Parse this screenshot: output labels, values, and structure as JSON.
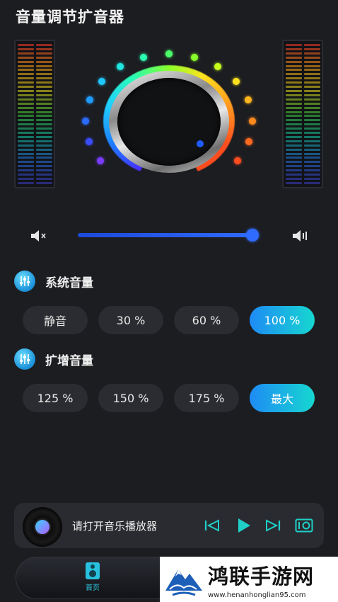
{
  "header": {
    "title": "音量调节扩音器"
  },
  "colors": {
    "background": "#1c1d21",
    "accent_blue": "#2f6bff",
    "active_gradient_start": "#1e8bf5",
    "active_gradient_end": "#16d7d0",
    "pill_bg": "#2b2c31"
  },
  "equalizer": {
    "left_icon": "equalizer-meter",
    "right_icon": "equalizer-meter"
  },
  "volume": {
    "level": 1.0,
    "mute_icon": "speaker-mute-icon",
    "volume_icon": "speaker-volume-icon"
  },
  "system_volume": {
    "label": "系统音量",
    "icon": "equalizer-sliders-icon",
    "options": [
      "静音",
      "30 %",
      "60 %",
      "100 %"
    ],
    "selected": "100 %"
  },
  "boost_volume": {
    "label": "扩增音量",
    "icon": "equalizer-sliders-icon",
    "options": [
      "125 %",
      "150 %",
      "175 %",
      "最大"
    ],
    "selected": "最大"
  },
  "player": {
    "text": "请打开音乐播放器",
    "buttons": [
      "previous-icon",
      "play-icon",
      "next-icon",
      "speaker-box-icon"
    ]
  },
  "nav": {
    "home_label": "首页",
    "home_icon": "speaker-icon"
  },
  "watermark": {
    "title": "鸿联手游网",
    "url": "www.henanhonglian95.com"
  }
}
